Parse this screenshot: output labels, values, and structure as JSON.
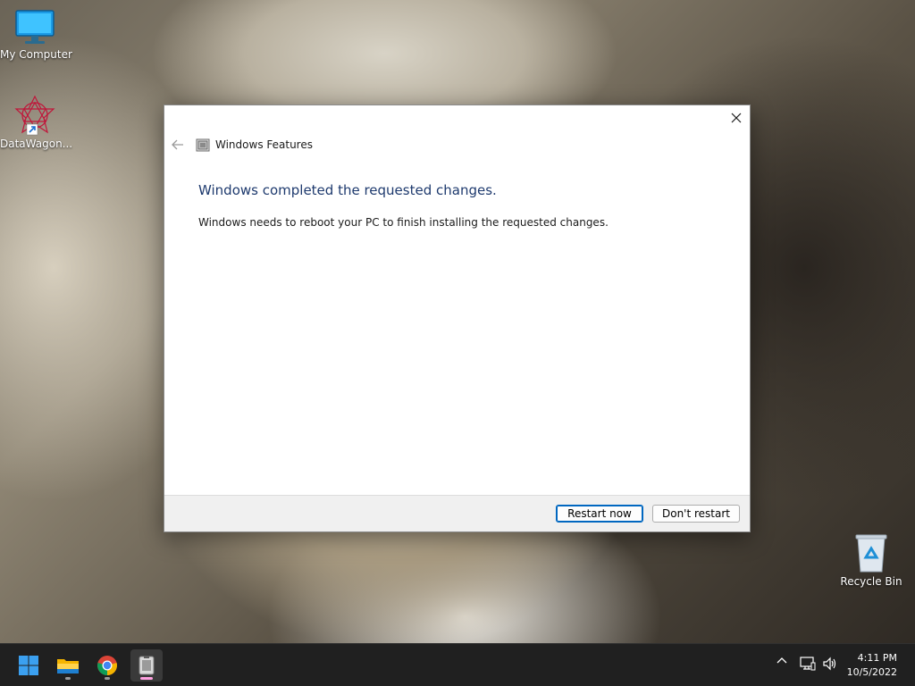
{
  "desktop": {
    "icons": [
      {
        "label": "My Computer",
        "icon": "monitor-icon"
      },
      {
        "label": "DataWagon...",
        "icon": "datawagon-shortcut-icon"
      },
      {
        "label": "Recycle Bin",
        "icon": "recycle-bin-icon"
      }
    ]
  },
  "dialog": {
    "title": "Windows Features",
    "heading": "Windows completed the requested changes.",
    "message": "Windows needs to reboot your PC to finish installing the requested changes.",
    "buttons": {
      "restart_now": "Restart now",
      "dont_restart": "Don't restart"
    }
  },
  "taskbar": {
    "apps": [
      {
        "name": "Start",
        "icon": "windows-start-icon"
      },
      {
        "name": "File Explorer",
        "icon": "folder-icon"
      },
      {
        "name": "Google Chrome",
        "icon": "chrome-icon"
      },
      {
        "name": "Windows Features",
        "icon": "windows-features-icon"
      }
    ],
    "tray": [
      "chevron-up-icon",
      "network-icon",
      "volume-icon"
    ],
    "time": "4:11 PM",
    "date": "10/5/2022"
  },
  "colors": {
    "heading": "#1e3a6e",
    "accent": "#0067c0",
    "taskbar": "#202020"
  }
}
